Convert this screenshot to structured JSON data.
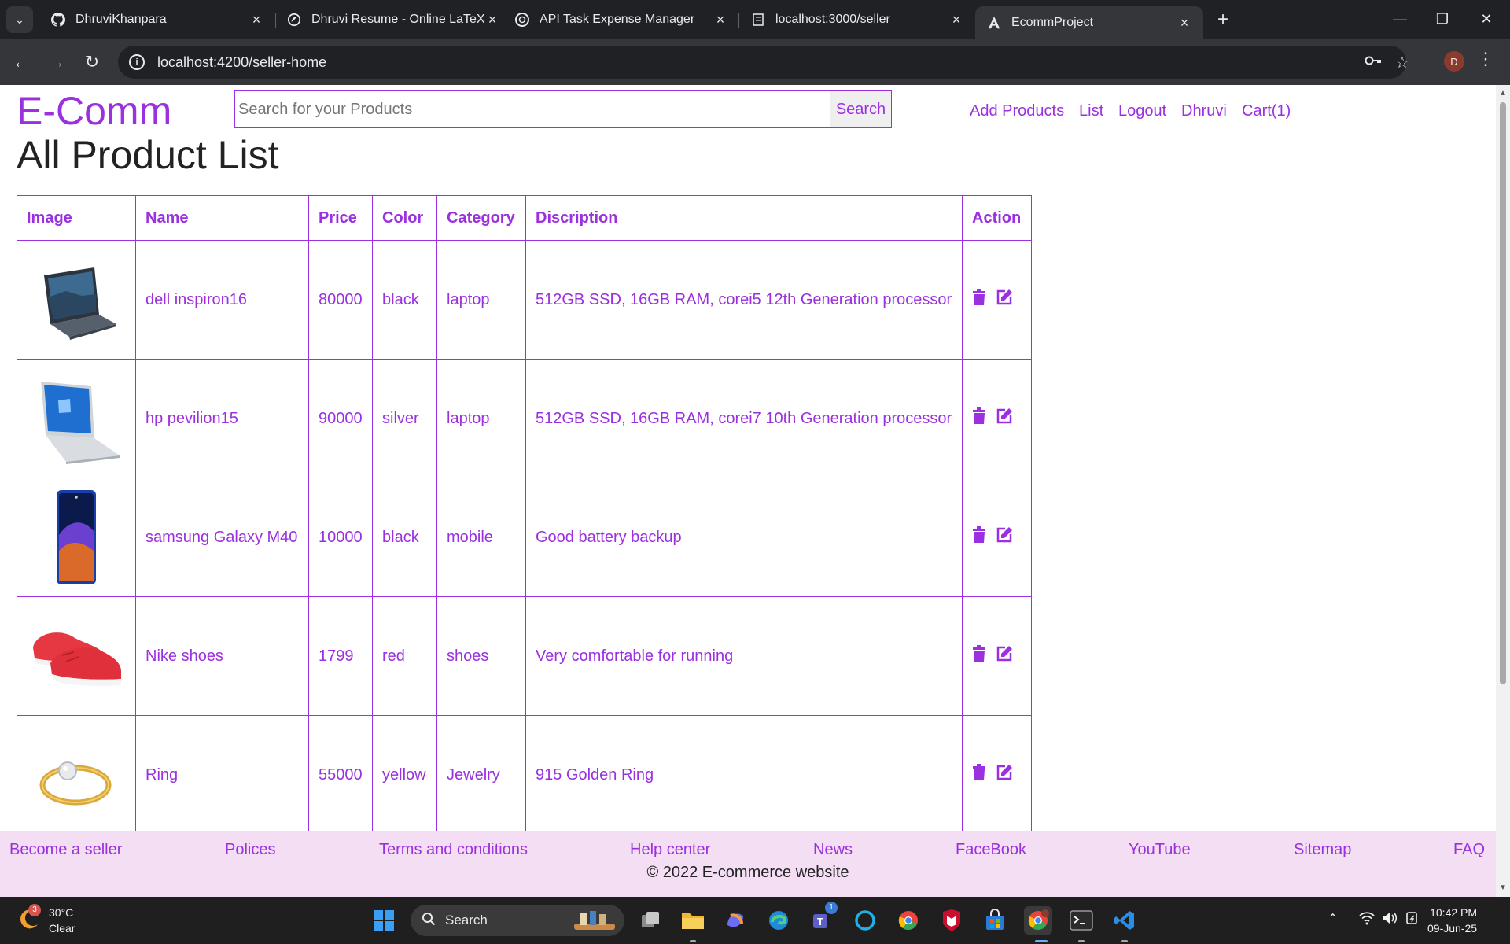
{
  "browser": {
    "tabs": [
      {
        "title": "DhruviKhanpara",
        "icon": "github-icon",
        "active": false
      },
      {
        "title": "Dhruvi Resume - Online LaTeX Editor",
        "icon": "overleaf-icon",
        "active": false
      },
      {
        "title": "API Task Expense Manager",
        "icon": "openai-icon",
        "active": false
      },
      {
        "title": "localhost:3000/seller",
        "icon": "page-icon",
        "active": false
      },
      {
        "title": "EcommProject",
        "icon": "angular-icon",
        "active": true
      }
    ],
    "url": "localhost:4200/seller-home",
    "profile_initial": "D"
  },
  "header": {
    "logo": "E-Comm",
    "search_placeholder": "Search for your Products",
    "search_button": "Search",
    "nav": [
      "Add Products",
      "List",
      "Logout",
      "Dhruvi",
      "Cart(1)"
    ]
  },
  "main": {
    "title": "All Product List",
    "columns": [
      "Image",
      "Name",
      "Price",
      "Color",
      "Category",
      "Discription",
      "Action"
    ],
    "products": [
      {
        "image": "laptop-dell",
        "name": "dell inspiron16",
        "price": "80000",
        "color": "black",
        "category": "laptop",
        "description": "512GB SSD, 16GB RAM, corei5 12th Generation processor"
      },
      {
        "image": "laptop-hp",
        "name": "hp pevilion15",
        "price": "90000",
        "color": "silver",
        "category": "laptop",
        "description": "512GB SSD, 16GB RAM, corei7 10th Generation processor"
      },
      {
        "image": "phone-samsung",
        "name": "samsung Galaxy M40",
        "price": "10000",
        "color": "black",
        "category": "mobile",
        "description": "Good battery backup"
      },
      {
        "image": "shoes-nike",
        "name": "Nike shoes",
        "price": "1799",
        "color": "red",
        "category": "shoes",
        "description": "Very comfortable for running"
      },
      {
        "image": "ring-gold",
        "name": "Ring",
        "price": "55000",
        "color": "yellow",
        "category": "Jewelry",
        "description": "915 Golden Ring"
      }
    ]
  },
  "footer": {
    "links": [
      "Become a seller",
      "Polices",
      "Terms and conditions",
      "Help center",
      "News",
      "FaceBook",
      "YouTube",
      "Sitemap",
      "FAQ"
    ],
    "copyright": "© 2022 E-commerce website"
  },
  "taskbar": {
    "weather_temp": "30°C",
    "weather_desc": "Clear",
    "weather_badge": "3",
    "search_label": "Search",
    "teams_badge": "1",
    "time": "10:42 PM",
    "date": "09-Jun-25"
  },
  "colors": {
    "accent": "#9b30e0",
    "footer_bg": "#f3def3",
    "chrome_dark": "#202124",
    "chrome_toolbar": "#35363a"
  }
}
